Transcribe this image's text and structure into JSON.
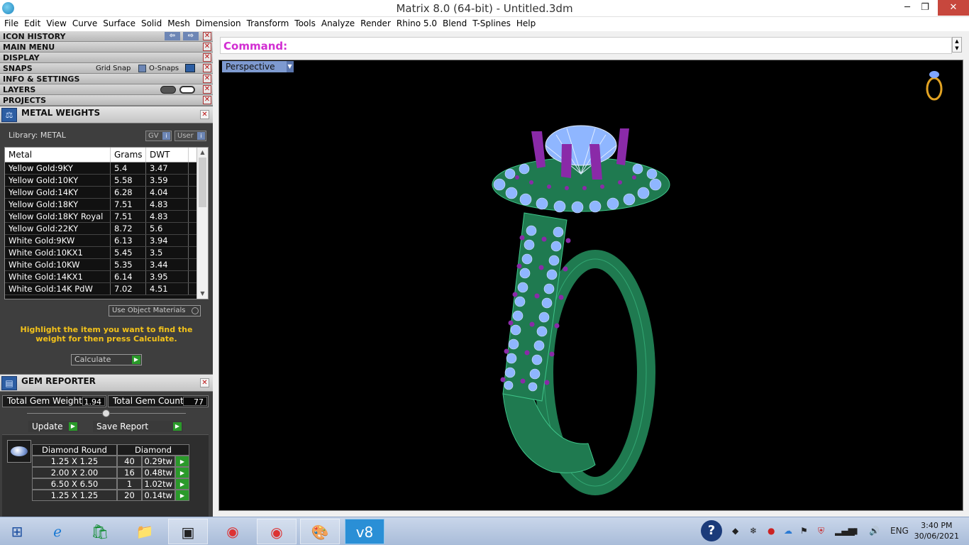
{
  "window": {
    "title": "Matrix 8.0 (64-bit) - Untitled.3dm",
    "minimize": "─",
    "restore": "❐",
    "close": "✕"
  },
  "menu": [
    "File",
    "Edit",
    "View",
    "Curve",
    "Surface",
    "Solid",
    "Mesh",
    "Dimension",
    "Transform",
    "Tools",
    "Analyze",
    "Render",
    "Rhino 5.0",
    "Blend",
    "T-Splines",
    "Help"
  ],
  "sections": {
    "icon_history": "ICON HISTORY",
    "main_menu": "MAIN MENU",
    "display": "DISPLAY",
    "snaps": "SNAPS",
    "grid_snap": "Grid Snap",
    "o_snaps": "O-Snaps",
    "info_settings": "INFO & SETTINGS",
    "layers": "LAYERS",
    "projects": "PROJECTS"
  },
  "metal_weights": {
    "title": "METAL WEIGHTS",
    "library": "Library: METAL",
    "gv": "GV",
    "user": "User",
    "headers": [
      "Metal",
      "Grams",
      "DWT"
    ],
    "rows": [
      [
        "Yellow Gold:9KY",
        "5.4",
        "3.47"
      ],
      [
        "Yellow Gold:10KY",
        "5.58",
        "3.59"
      ],
      [
        "Yellow Gold:14KY",
        "6.28",
        "4.04"
      ],
      [
        "Yellow Gold:18KY",
        "7.51",
        "4.83"
      ],
      [
        "Yellow Gold:18KY Royal",
        "7.51",
        "4.83"
      ],
      [
        "Yellow Gold:22KY",
        "8.72",
        "5.6"
      ],
      [
        "White Gold:9KW",
        "6.13",
        "3.94"
      ],
      [
        "White Gold:10KX1",
        "5.45",
        "3.5"
      ],
      [
        "White Gold:10KW",
        "5.35",
        "3.44"
      ],
      [
        "White Gold:14KX1",
        "6.14",
        "3.95"
      ],
      [
        "White Gold:14K PdW",
        "7.02",
        "4.51"
      ]
    ],
    "use_object_materials": "Use Object Materials",
    "hint": "Highlight the item you want to find the weight for then press Calculate.",
    "calculate": "Calculate"
  },
  "gem_reporter": {
    "title": "GEM REPORTER",
    "total_weight_label": "Total Gem Weight",
    "total_weight": "1.94",
    "total_count_label": "Total Gem Count",
    "total_count": "77",
    "update": "Update",
    "save_report": "Save Report",
    "headers": [
      "Diamond Round",
      "Diamond"
    ],
    "rows": [
      [
        "1.25 X 1.25",
        "40",
        "0.29tw"
      ],
      [
        "2.00 X 2.00",
        "16",
        "0.48tw"
      ],
      [
        "6.50 X 6.50",
        "1",
        "1.02tw"
      ],
      [
        "1.25 X 1.25",
        "20",
        "0.14tw"
      ]
    ]
  },
  "command": {
    "label": "Command:",
    "value": ""
  },
  "viewport": {
    "label": "Perspective"
  },
  "taskbar": {
    "lang": "ENG",
    "time": "3:40 PM",
    "date": "30/06/2021"
  },
  "colors": {
    "accent": "#d22fd2",
    "metal": "#1f7a50",
    "stone": "#8fb6ff",
    "purple_stone": "#8a2aa8",
    "viewport_bg": "#000000"
  }
}
